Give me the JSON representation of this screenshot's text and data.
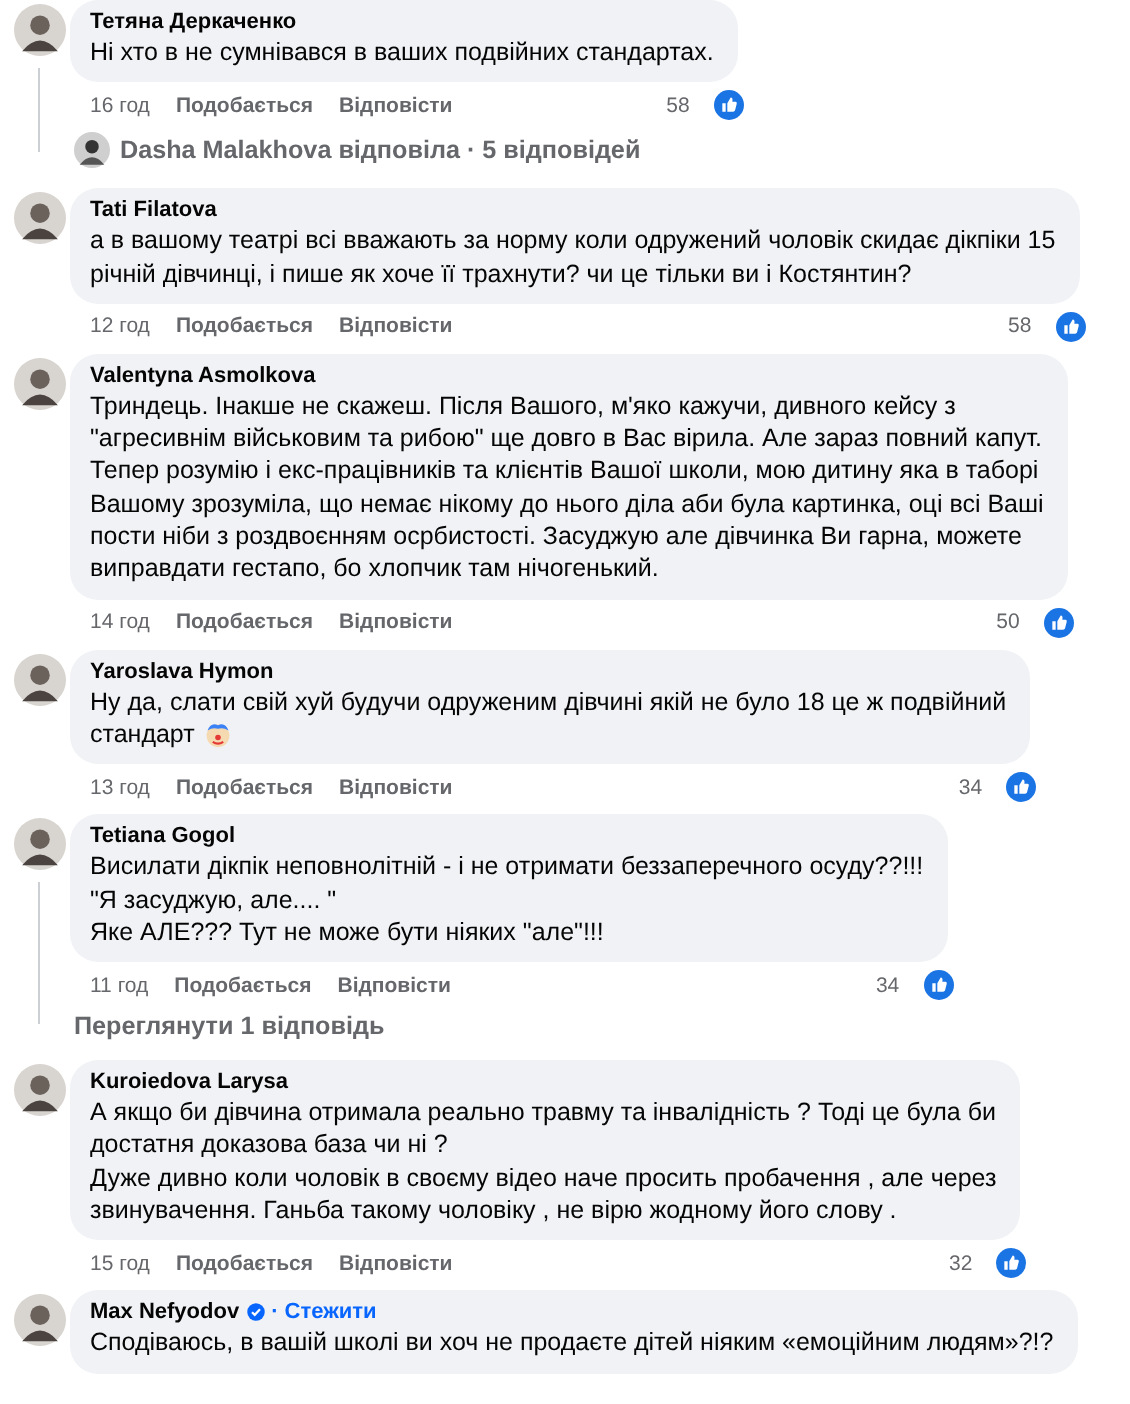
{
  "comments": [
    {
      "author": "Тетяна Деркаченко",
      "text": "Ні хто в не сумнівався в ваших подвійних стандартах.",
      "time": "16 год",
      "like": "Подобається",
      "reply": "Відповісти",
      "likes": "58",
      "replies_summary": {
        "text": "Dasha Malakhova відповіла · 5 відповідей",
        "kind": "avatar"
      }
    },
    {
      "author": "Tati Filatova",
      "text": "а в вашому театрі всі вважають за норму коли одружений чоловік скидає дікпіки 15\nрічній дівчинці, і пише як хоче її трахнути? чи це тільки ви і Костянтин?",
      "time": "12 год",
      "like": "Подобається",
      "reply": "Відповісти",
      "likes": "58"
    },
    {
      "author": "Valentyna Asmolkova",
      "text": "Триндець. Інакше не скажеш. Після Вашого, м'яко кажучи, дивного кейсу з\n\"агресивнім військовим та рибою\" ще довго в Вас вірила. Але зараз повний капут.\nТепер розумію і екс-працівників та клієнтів Вашої школи, мою дитину яка в таборі\nВашому зрозуміла, що немає нікому до нього діла аби була картинка, оці всі Ваші\nпости ніби з роздвоєнням осрбистості. Засуджую але дівчинка Ви гарна, можете\nвиправдати гестапо, бо хлопчик там нічогенький.",
      "time": "14 год",
      "like": "Подобається",
      "reply": "Відповісти",
      "likes": "50"
    },
    {
      "author": "Yaroslava Hymon",
      "text": "Ну да, слати свій хуй будучи одруженим дівчині якій не було 18 це ж подвійний",
      "text_tail": "стандарт",
      "clown_emoji": true,
      "time": "13 год",
      "like": "Подобається",
      "reply": "Відповісти",
      "likes": "34"
    },
    {
      "author": "Tetiana Gogol",
      "text": "Висилати дікпік неповнолітній - і не отримати беззаперечного осуду??!!!\n\"Я засуджую, але.... \"\nЯке АЛЕ??? Тут не може бути ніяких \"але\"!!!",
      "time": "11 год",
      "like": "Подобається",
      "reply": "Відповісти",
      "likes": "34",
      "replies_summary": {
        "text": "Переглянути 1 відповідь",
        "kind": "plain"
      }
    },
    {
      "author": "Kuroiedova Larysa",
      "text": "А якщо би дівчина отримала реально травму та інвалідність ? Тоді це була би\nдостатня доказова база чи ні ?\nДуже дивно коли чоловік в своєму відео наче просить пробачення , але через\nзвинувачення. Ганьба такому чоловіку , не вірю жодному його слову .",
      "time": "15 год",
      "like": "Подобається",
      "reply": "Відповісти",
      "likes": "32"
    },
    {
      "author": "Max Nefyodov",
      "verified": true,
      "follow": "· Стежити",
      "text": "Сподіваюсь, в вашій школі ви хоч не продаєте дітей ніяким «емоційним людям»?!?"
    }
  ]
}
